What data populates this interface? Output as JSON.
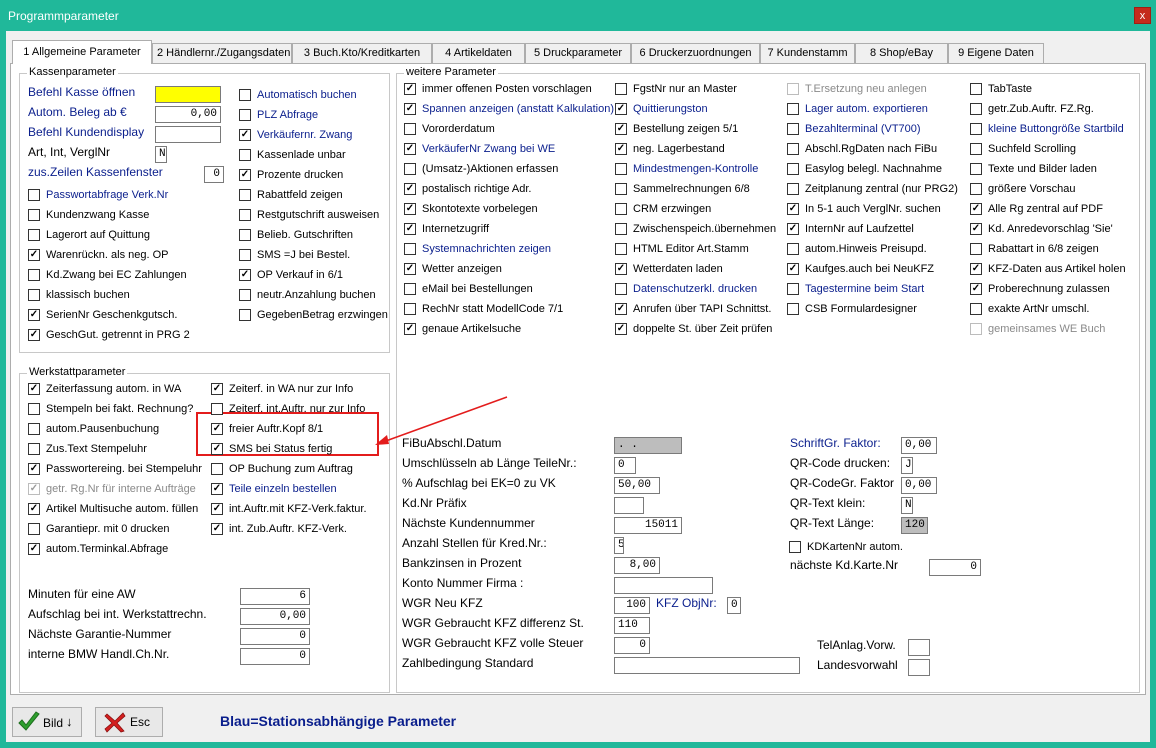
{
  "title": "Programmparameter",
  "close": "x",
  "tabs": [
    "1 Allgemeine Parameter",
    "2 Händlernr./Zugangsdaten",
    "3 Buch.Kto/Kreditkarten",
    "4 Artikeldaten",
    "5 Druckparameter",
    "6 Druckerzuordnungen",
    "7 Kundenstamm",
    "8 Shop/eBay",
    "9 Eigene Daten"
  ],
  "kasse": {
    "title": "Kassenparameter",
    "fields": [
      {
        "label": "Befehl Kasse öffnen",
        "value": ""
      },
      {
        "label": "Autom. Beleg ab €",
        "value": "0,00"
      },
      {
        "label": "Befehl Kundendisplay",
        "value": ""
      },
      {
        "label": "Art, Int, VerglNr",
        "value": "N"
      },
      {
        "label": "zus.Zeilen Kassenfenster",
        "value": "0"
      }
    ],
    "left": [
      {
        "l": "Passwortabfrage Verk.Nr",
        "c": false
      },
      {
        "l": "Kundenzwang Kasse",
        "c": false
      },
      {
        "l": "Lagerort auf Quittung",
        "c": false
      },
      {
        "l": "Warenrückn. als neg. OP",
        "c": true
      },
      {
        "l": "Kd.Zwang bei EC Zahlungen",
        "c": false
      },
      {
        "l": "klassisch buchen",
        "c": false
      },
      {
        "l": "SerienNr Geschenkgutsch.",
        "c": true
      },
      {
        "l": "GeschGut. getrennt in PRG 2",
        "c": true
      }
    ],
    "right": [
      {
        "l": "Automatisch buchen",
        "c": false
      },
      {
        "l": "PLZ Abfrage",
        "c": false
      },
      {
        "l": "Verkäufernr. Zwang",
        "c": true
      },
      {
        "l": "Kassenlade unbar",
        "c": false
      },
      {
        "l": "Prozente drucken",
        "c": true
      },
      {
        "l": "Rabattfeld zeigen",
        "c": false
      },
      {
        "l": "Restgutschrift ausweisen",
        "c": false
      },
      {
        "l": "Belieb. Gutschriften",
        "c": false
      },
      {
        "l": "SMS =J bei Bestel.",
        "c": false
      },
      {
        "l": "OP Verkauf in 6/1",
        "c": true
      },
      {
        "l": "neutr.Anzahlung buchen",
        "c": false
      },
      {
        "l": "GegebenBetrag erzwingen",
        "c": false
      }
    ]
  },
  "werk": {
    "title": "Werkstattparameter",
    "left": [
      {
        "l": "Zeiterfassung autom. in WA",
        "c": true
      },
      {
        "l": "Stempeln bei fakt. Rechnung?",
        "c": false
      },
      {
        "l": "autom.Pausenbuchung",
        "c": false
      },
      {
        "l": "Zus.Text Stempeluhr",
        "c": false
      },
      {
        "l": "Passwortereing. bei Stempeluhr",
        "c": true
      },
      {
        "l": "getr. Rg.Nr für interne Aufträge",
        "c": true
      },
      {
        "l": "Artikel Multisuche autom. füllen",
        "c": true
      },
      {
        "l": "Garantiepr. mit 0 drucken",
        "c": false
      },
      {
        "l": "autom.Terminkal.Abfrage",
        "c": true
      }
    ],
    "right": [
      {
        "l": "Zeiterf. in WA nur zur Info",
        "c": true
      },
      {
        "l": "Zeiterf. int.Auftr. nur zur Info",
        "c": false
      },
      {
        "l": "freier Auftr.Kopf 8/1",
        "c": true
      },
      {
        "l": "SMS bei Status fertig",
        "c": true
      },
      {
        "l": "OP Buchung zum Auftrag",
        "c": false
      },
      {
        "l": "Teile einzeln bestellen",
        "c": true
      },
      {
        "l": "int.Auftr.mit KFZ-Verk.faktur.",
        "c": true
      },
      {
        "l": "int. Zub.Auftr. KFZ-Verk.",
        "c": true
      }
    ],
    "fields": [
      {
        "label": "Minuten für eine AW",
        "value": "6"
      },
      {
        "label": "Aufschlag bei int. Werkstattrechn.",
        "value": "0,00"
      },
      {
        "label": "Nächste Garantie-Nummer",
        "value": "0"
      },
      {
        "label": "interne BMW Handl.Ch.Nr.",
        "value": "0"
      }
    ]
  },
  "weitere": {
    "title": "weitere Parameter",
    "col1": [
      {
        "l": "immer offenen Posten vorschlagen",
        "c": true
      },
      {
        "l": "Spannen anzeigen (anstatt Kalkulation)",
        "c": true
      },
      {
        "l": "Vororderdatum",
        "c": false
      },
      {
        "l": "VerkäuferNr Zwang bei WE",
        "c": true
      },
      {
        "l": "(Umsatz-)Aktionen erfassen",
        "c": false
      },
      {
        "l": "postalisch richtige Adr.",
        "c": true
      },
      {
        "l": "Skontotexte vorbelegen",
        "c": true
      },
      {
        "l": "Internetzugriff",
        "c": true
      },
      {
        "l": "Systemnachrichten zeigen",
        "c": false
      },
      {
        "l": "Wetter anzeigen",
        "c": true
      },
      {
        "l": "eMail bei Bestellungen",
        "c": false
      },
      {
        "l": "RechNr statt ModellCode 7/1",
        "c": false
      },
      {
        "l": "genaue Artikelsuche",
        "c": true
      }
    ],
    "col2": [
      {
        "l": "FgstNr nur an Master",
        "c": false
      },
      {
        "l": "Quittierungston",
        "c": true
      },
      {
        "l": "Bestellung zeigen 5/1",
        "c": true
      },
      {
        "l": "neg. Lagerbestand",
        "c": true
      },
      {
        "l": "Mindestmengen-Kontrolle",
        "c": false
      },
      {
        "l": "Sammelrechnungen 6/8",
        "c": false
      },
      {
        "l": "CRM erzwingen",
        "c": false
      },
      {
        "l": "Zwischenspeich.übernehmen",
        "c": false
      },
      {
        "l": "HTML Editor Art.Stamm",
        "c": false
      },
      {
        "l": "Wetterdaten laden",
        "c": true
      },
      {
        "l": "Datenschutzerkl. drucken",
        "c": false
      },
      {
        "l": "Anrufen über TAPI Schnittst.",
        "c": true
      },
      {
        "l": "doppelte St. über Zeit prüfen",
        "c": true
      }
    ],
    "col3": [
      {
        "l": "T.Ersetzung neu anlegen",
        "c": false
      },
      {
        "l": "Lager autom. exportieren",
        "c": false
      },
      {
        "l": "Bezahlterminal (VT700)",
        "c": false
      },
      {
        "l": "Abschl.RgDaten nach FiBu",
        "c": false
      },
      {
        "l": "Easylog belegl. Nachnahme",
        "c": false
      },
      {
        "l": "Zeitplanung zentral (nur PRG2)",
        "c": false
      },
      {
        "l": "In 5-1 auch VerglNr. suchen",
        "c": true
      },
      {
        "l": "InternNr auf Laufzettel",
        "c": true
      },
      {
        "l": "autom.Hinweis Preisupd.",
        "c": false
      },
      {
        "l": "Kaufges.auch bei NeuKFZ",
        "c": true
      },
      {
        "l": "Tagestermine beim Start",
        "c": false
      },
      {
        "l": "CSB Formulardesigner",
        "c": false
      }
    ],
    "col4": [
      {
        "l": "TabTaste",
        "c": false
      },
      {
        "l": "getr.Zub.Auftr. FZ.Rg.",
        "c": false
      },
      {
        "l": "kleine Buttongröße Startbild",
        "c": false
      },
      {
        "l": "Suchfeld Scrolling",
        "c": false
      },
      {
        "l": "Texte und Bilder laden",
        "c": false
      },
      {
        "l": "größere Vorschau",
        "c": false
      },
      {
        "l": "Alle Rg zentral auf PDF",
        "c": true
      },
      {
        "l": "Kd. Anredevorschlag 'Sie'",
        "c": true
      },
      {
        "l": "Rabattart in 6/8 zeigen",
        "c": false
      },
      {
        "l": "KFZ-Daten aus Artikel holen",
        "c": true
      },
      {
        "l": "Proberechnung zulassen",
        "c": true
      },
      {
        "l": "exakte ArtNr umschl.",
        "c": false
      },
      {
        "l": "gemeinsames WE Buch",
        "c": false
      }
    ],
    "fields": [
      {
        "label": "FiBuAbschl.Datum",
        "value": ". ."
      },
      {
        "label": "Umschlüsseln ab Länge TeileNr.:",
        "value": "0"
      },
      {
        "label": "% Aufschlag bei EK=0 zu VK",
        "value": "50,00"
      },
      {
        "label": "Kd.Nr Präfix",
        "value": ""
      },
      {
        "label": "Nächste Kundennummer",
        "value": "15011"
      },
      {
        "label": "Anzahl Stellen für Kred.Nr.:",
        "value": "5"
      },
      {
        "label": "Bankzinsen in Prozent",
        "value": "8,00"
      },
      {
        "label": "Konto Nummer Firma     :",
        "value": ""
      },
      {
        "label": "WGR Neu KFZ",
        "value": "100"
      },
      {
        "label": "WGR Gebraucht KFZ differenz St.",
        "value": "110"
      },
      {
        "label": "WGR Gebraucht KFZ volle Steuer",
        "value": "0"
      },
      {
        "label": "Zahlbedingung Standard",
        "value": ""
      }
    ],
    "kfzobj": {
      "label": "KFZ ObjNr:",
      "value": "0"
    },
    "rfields": [
      {
        "label": "SchriftGr. Faktor:",
        "value": "0,00"
      },
      {
        "label": "QR-Code drucken:",
        "value": "J"
      },
      {
        "label": "QR-CodeGr. Faktor",
        "value": "0,00"
      },
      {
        "label": "QR-Text klein:",
        "value": "N"
      },
      {
        "label": "QR-Text Länge:",
        "value": "120"
      }
    ],
    "kdkarte": {
      "l": "KDKartenNr autom.",
      "c": false
    },
    "kdkarte_next": {
      "label": "nächste Kd.Karte.Nr",
      "value": "0"
    },
    "tel": {
      "label": "TelAnlag.Vorw.",
      "value": ""
    },
    "landes": {
      "label": "Landesvorwahl",
      "value": ""
    }
  },
  "buttons": {
    "ok": "Bild",
    "esc": "Esc"
  },
  "footnote": "Blau=Stationsabhängige Parameter"
}
